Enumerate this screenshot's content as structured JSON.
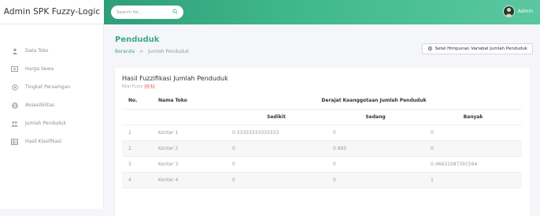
{
  "brand": {
    "title": "Admin SPK Fuzzy-Logic"
  },
  "topbar": {
    "search_placeholder": "Search for...",
    "user_name": "Admin",
    "accent": "#3fb98b"
  },
  "sidebar": {
    "items": [
      {
        "label": "Data Toko",
        "icon": "user-icon"
      },
      {
        "label": "Harga Sewa",
        "icon": "money-icon"
      },
      {
        "label": "Tingkat Persaingan",
        "icon": "target-icon"
      },
      {
        "label": "Aksesibilitas",
        "icon": "globe-icon"
      },
      {
        "label": "Jumlah Penduduk",
        "icon": "users-icon"
      },
      {
        "label": "Hasil Klasifikasi",
        "icon": "table-icon"
      }
    ]
  },
  "page": {
    "title": "Penduduk",
    "breadcrumb": {
      "home": "Beranda",
      "sep": ">",
      "current": "Jumlah Penduduk"
    },
    "setting_button": "Setel Himpunan Variabel Jumlah Penduduk"
  },
  "card": {
    "title": "Hasil Fuzzifikasi Jumlah Penduduk",
    "subtitle": "Nilai Fuzzy",
    "subtitle_badge": "[0-1]"
  },
  "table": {
    "headers": {
      "no": "No.",
      "nama": "Nama Toko",
      "group": "Derajat Keanggotaan Jumlah Penduduk"
    },
    "subheaders": [
      "Sedikit",
      "Sedang",
      "Banyak"
    ],
    "rows": [
      {
        "no": "1",
        "nama": "Konter 1",
        "sedikit": "0.33333333333333",
        "sedang": "0",
        "banyak": "0"
      },
      {
        "no": "2",
        "nama": "Konter 2",
        "sedikit": "0",
        "sedang": "0.895",
        "banyak": "0"
      },
      {
        "no": "3",
        "nama": "Konter 3",
        "sedikit": "0",
        "sedang": "0",
        "banyak": "0.46631087391594"
      },
      {
        "no": "4",
        "nama": "Konter 4",
        "sedikit": "0",
        "sedang": "0",
        "banyak": "1"
      }
    ]
  }
}
